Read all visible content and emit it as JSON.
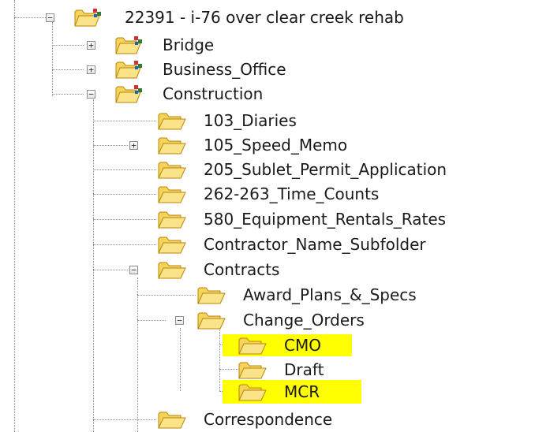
{
  "tree": {
    "root": {
      "label": "22391 - i-76 over clear creek rehab",
      "toggle": "−",
      "icon": "project-folder-icon"
    },
    "items": [
      {
        "label": "Bridge",
        "toggle": "+",
        "icon": "project-folder-icon"
      },
      {
        "label": "Business_Office",
        "toggle": "+",
        "icon": "project-folder-icon"
      },
      {
        "label": "Construction",
        "toggle": "−",
        "icon": "project-folder-icon"
      }
    ],
    "construction": [
      {
        "label": "103_Diaries",
        "icon": "folder-icon"
      },
      {
        "label": "105_Speed_Memo",
        "toggle": "+",
        "icon": "folder-icon"
      },
      {
        "label": "205_Sublet_Permit_Application",
        "icon": "folder-icon"
      },
      {
        "label": "262-263_Time_Counts",
        "icon": "folder-icon"
      },
      {
        "label": "580_Equipment_Rentals_Rates",
        "icon": "folder-icon"
      },
      {
        "label": "Contractor_Name_Subfolder",
        "icon": "folder-icon"
      },
      {
        "label": "Contracts",
        "toggle": "−",
        "icon": "folder-icon"
      },
      {
        "label": "Correspondence",
        "icon": "folder-icon"
      }
    ],
    "contracts": [
      {
        "label": "Award_Plans_&_Specs",
        "icon": "folder-icon"
      },
      {
        "label": "Change_Orders",
        "toggle": "−",
        "icon": "folder-icon"
      }
    ],
    "change_orders": [
      {
        "label": "CMO",
        "icon": "folder-icon",
        "highlighted": true
      },
      {
        "label": "Draft",
        "icon": "folder-icon",
        "highlighted": false
      },
      {
        "label": "MCR",
        "icon": "folder-icon",
        "highlighted": true
      }
    ]
  },
  "colors": {
    "highlight": "#ffff00",
    "folder_fill": "#f6d35a",
    "folder_outline": "#b8860b",
    "badge_red": "#d32f2f",
    "badge_green": "#2e7d32",
    "badge_blue": "#1565c0"
  }
}
